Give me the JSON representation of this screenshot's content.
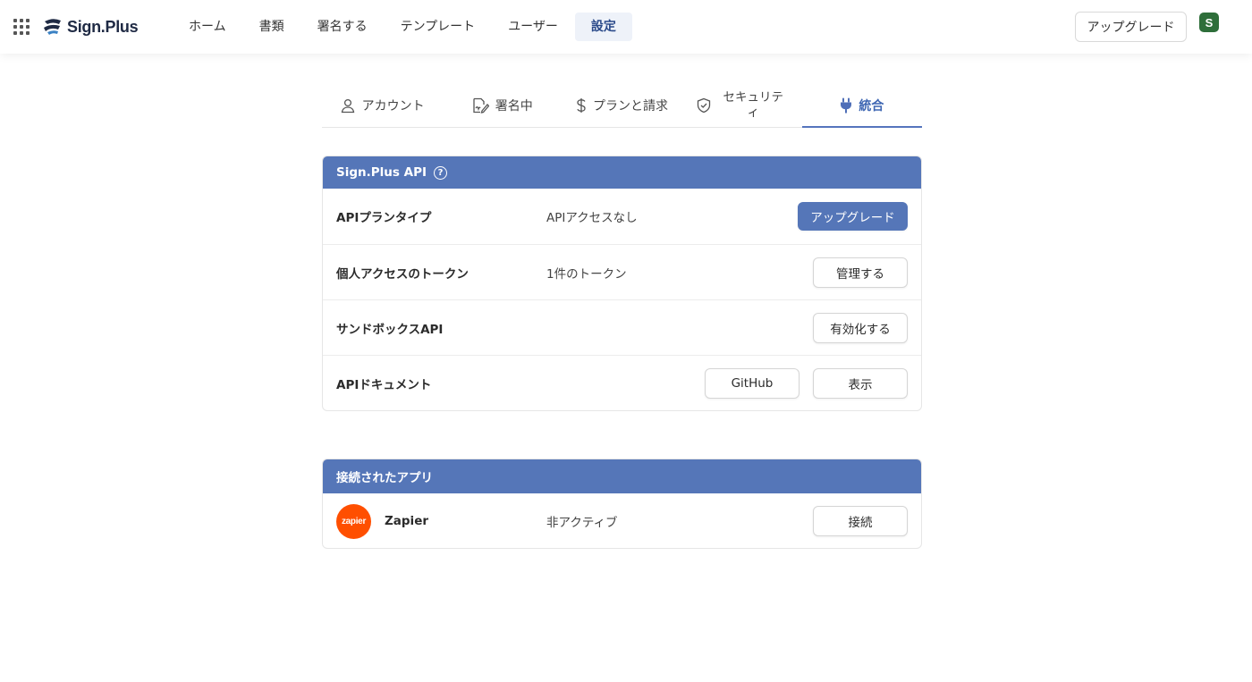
{
  "app": {
    "name": "Sign.Plus"
  },
  "nav": {
    "items": [
      {
        "label": "ホーム",
        "active": false
      },
      {
        "label": "書類",
        "active": false
      },
      {
        "label": "署名する",
        "active": false
      },
      {
        "label": "テンプレート",
        "active": false
      },
      {
        "label": "ユーザー",
        "active": false
      },
      {
        "label": "設定",
        "active": true
      }
    ],
    "upgrade_label": "アップグレード",
    "avatar_initial": "S"
  },
  "tabs": [
    {
      "label": "アカウント",
      "icon": "user-icon",
      "active": false
    },
    {
      "label": "署名中",
      "icon": "sign-document-icon",
      "active": false
    },
    {
      "label": "プランと請求",
      "icon": "dollar-icon",
      "active": false
    },
    {
      "label": "セキュリティ",
      "icon": "shield-check-icon",
      "active": false
    },
    {
      "label": "統合",
      "icon": "plug-icon",
      "active": true
    }
  ],
  "api_card": {
    "title": "Sign.Plus API",
    "help_glyph": "?",
    "rows": [
      {
        "label": "APIプランタイプ",
        "value": "APIアクセスなし",
        "buttons": [
          "アップグレード"
        ]
      },
      {
        "label": "個人アクセスのトークン",
        "value": "1件のトークン",
        "buttons": [
          "管理する"
        ]
      },
      {
        "label": "サンドボックスAPI",
        "value": "",
        "buttons": [
          "有効化する"
        ]
      },
      {
        "label": "APIドキュメント",
        "value": "",
        "buttons": [
          "GitHub",
          "表示"
        ]
      }
    ]
  },
  "apps_card": {
    "title": "接続されたアプリ",
    "apps": [
      {
        "logo_text": "zapier",
        "name": "Zapier",
        "status": "非アクティブ",
        "button": "接続"
      }
    ]
  },
  "colors": {
    "accent": "#5576b8",
    "zapier": "#ff4f00"
  }
}
